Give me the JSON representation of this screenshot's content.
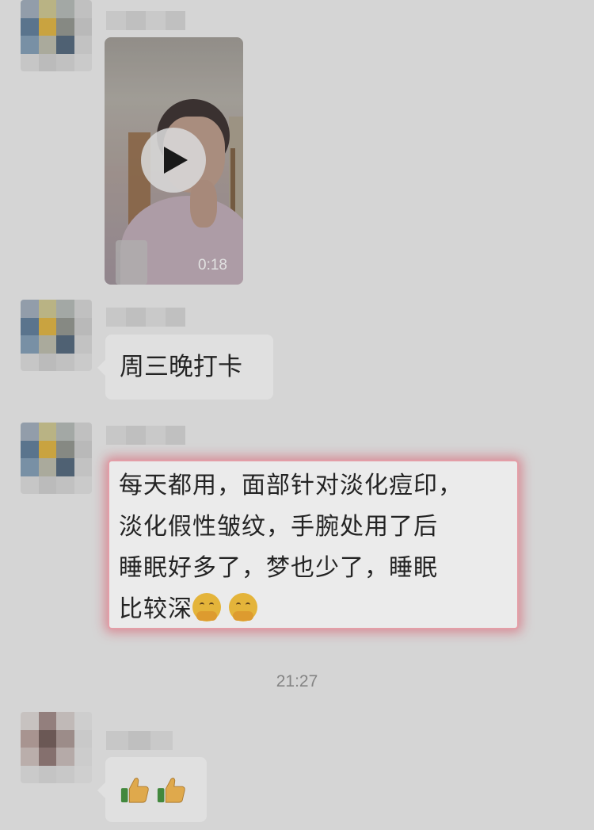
{
  "messages": [
    {
      "type": "video",
      "duration": "0:18"
    },
    {
      "type": "text",
      "text": "周三晚打卡"
    },
    {
      "type": "text",
      "lines": [
        "每天都用，面部针对淡化痘印，",
        "淡化假性皱纹，手腕处用了后",
        "睡眠好多了，梦也少了，睡眠",
        "比较深"
      ],
      "trailing_icons": [
        "hugging-face-icon",
        "hugging-face-icon"
      ]
    },
    {
      "type": "emoji",
      "icons": [
        "thumbs-up-icon",
        "thumbs-up-icon"
      ]
    }
  ],
  "timestamp": "21:27",
  "colors": {
    "highlight": "#ee5a6e",
    "bubble": "#f3f3f3",
    "background": "#e6e6e6"
  }
}
